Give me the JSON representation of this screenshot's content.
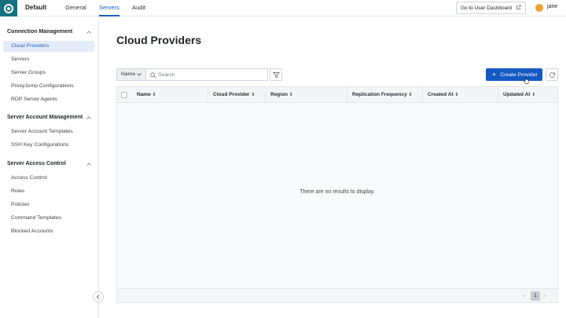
{
  "topbar": {
    "workspace": "Default",
    "tabs": [
      {
        "label": "General",
        "active": false
      },
      {
        "label": "Servers",
        "active": true
      },
      {
        "label": "Audit",
        "active": false
      }
    ],
    "user_dashboard_label": "Go to User Dashboard",
    "avatar_initial": "",
    "username": "jane"
  },
  "sidebar": {
    "sections": [
      {
        "title": "Connection Management",
        "items": [
          "Cloud Providers",
          "Servers",
          "Server Groups",
          "ProxyJump Configurations",
          "RDP Server Agents"
        ]
      },
      {
        "title": "Server Account Management",
        "items": [
          "Server Account Templates",
          "SSH Key Configurations"
        ]
      },
      {
        "title": "Server Access Control",
        "items": [
          "Access Control",
          "Roles",
          "Policies",
          "Command Templates",
          "Blocked Accounts"
        ]
      }
    ],
    "active_item": "Cloud Providers"
  },
  "main": {
    "title": "Cloud Providers",
    "filter_field": "Name",
    "search_placeholder": "Search",
    "create_button": "Create Provider",
    "columns": [
      "Name",
      "Cloud Provider",
      "Region",
      "Replication Frequency",
      "Created At",
      "Updated At"
    ],
    "empty_message": "There are no results to display.",
    "pagination": {
      "current_page": "1",
      "prev": "‹",
      "next": "›"
    }
  },
  "colors": {
    "accent": "#1459c5",
    "logo_bg": "#16707f",
    "active_bg": "#e4ecf8"
  }
}
